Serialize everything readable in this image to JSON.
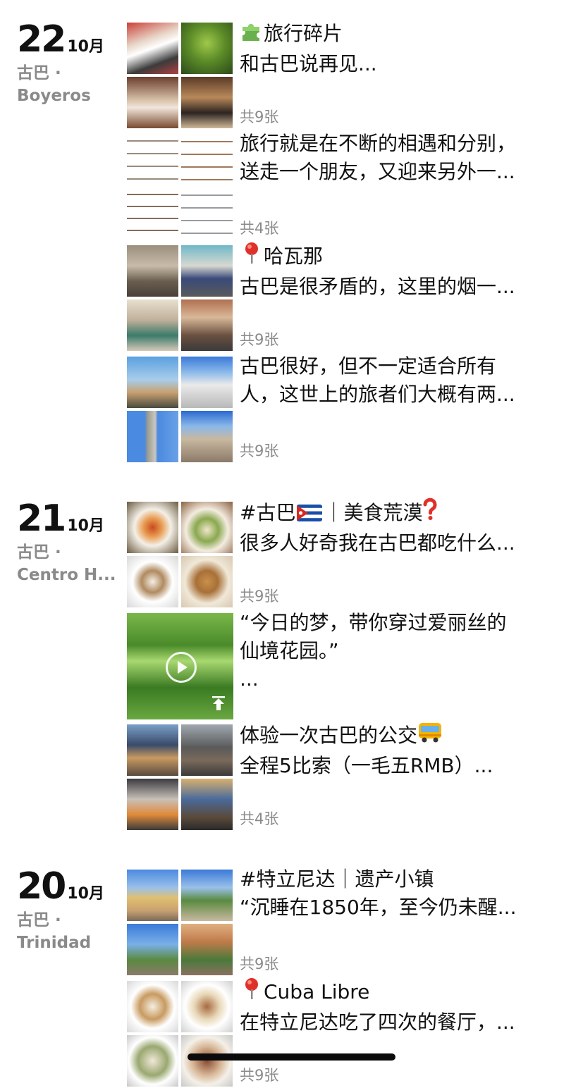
{
  "days": [
    {
      "day": "22",
      "month": "10月",
      "loc1": "古巴 ·",
      "loc2": "Boyeros",
      "posts": [
        {
          "emoji": "puzzle-icon",
          "title": "旅行碎片",
          "body": "和古巴说再见...",
          "count": "共9张"
        },
        {
          "line1": "旅行就是在不断的相遇和分别，",
          "line2": "送走一个朋友，又迎来另外一...",
          "count": "共4张"
        },
        {
          "emoji": "pin-icon",
          "title": "哈瓦那",
          "body": "古巴是很矛盾的，这里的烟一...",
          "count": "共9张"
        },
        {
          "line1": "古巴很好，但不一定适合所有",
          "line2": "人，这世上的旅者们大概有两...",
          "count": "共9张"
        }
      ]
    },
    {
      "day": "21",
      "month": "10月",
      "loc1": "古巴 ·",
      "loc2": "Centro H...",
      "posts": [
        {
          "title_a": "#古巴",
          "title_b": "｜美食荒漠",
          "body": "很多人好奇我在古巴都吃什么...",
          "count": "共9张"
        },
        {
          "line1": "“今日的梦，带你穿过爱丽丝的",
          "line2": "仙境花园。”",
          "line3": "..."
        },
        {
          "title": "体验一次古巴的公交",
          "body": "全程5比索（一毛五RMB）...",
          "count": "共4张"
        }
      ]
    },
    {
      "day": "20",
      "month": "10月",
      "loc1": "古巴 ·",
      "loc2": "Trinidad",
      "posts": [
        {
          "title": "#特立尼达｜遗产小镇",
          "body": "“沉睡在1850年，至今仍未醒...",
          "count": "共9张"
        },
        {
          "emoji": "pin-icon",
          "title": "Cuba Libre",
          "body": "在特立尼达吃了四次的餐厅，...",
          "count": "共9张"
        }
      ]
    }
  ]
}
